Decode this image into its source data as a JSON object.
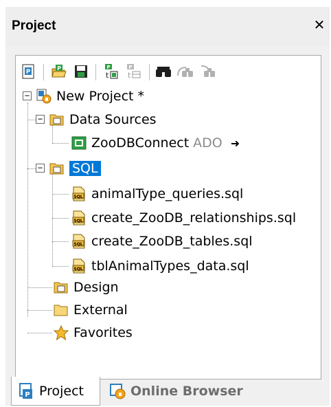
{
  "panel": {
    "title": "Project",
    "close_label": "✕"
  },
  "toolbar": {
    "buttons": [
      {
        "name": "new-project",
        "icon": "new-project-icon",
        "enabled": true
      },
      {
        "name": "open-project",
        "icon": "open-project-icon",
        "enabled": true
      },
      {
        "name": "save-project",
        "icon": "save-project-icon",
        "enabled": true
      },
      {
        "name": "add-data-source",
        "icon": "add-data-source-icon",
        "enabled": true
      },
      {
        "name": "add-folder",
        "icon": "add-folder-icon",
        "enabled": false
      },
      {
        "name": "find",
        "icon": "binoculars-icon",
        "enabled": true
      },
      {
        "name": "find-next",
        "icon": "find-next-icon",
        "enabled": false
      },
      {
        "name": "find-previous",
        "icon": "find-previous-icon",
        "enabled": false
      }
    ]
  },
  "tree": {
    "project": "New Project *",
    "data_sources": "Data Sources",
    "connection": {
      "name": "ZooDBConnect",
      "kind": "ADO",
      "arrow": "➜"
    },
    "sql_folder": "SQL",
    "sql_files": [
      "animalType_queries.sql",
      "create_ZooDB_relationships.sql",
      "create_ZooDB_tables.sql",
      "tblAnimalTypes_data.sql"
    ],
    "design": "Design",
    "external": "External",
    "favorites": "Favorites"
  },
  "tabs": {
    "project": "Project",
    "online_browser": "Online Browser"
  },
  "colors": {
    "selection": "#0078d7",
    "folder": "#f5c451",
    "db": "#2e9e44"
  }
}
